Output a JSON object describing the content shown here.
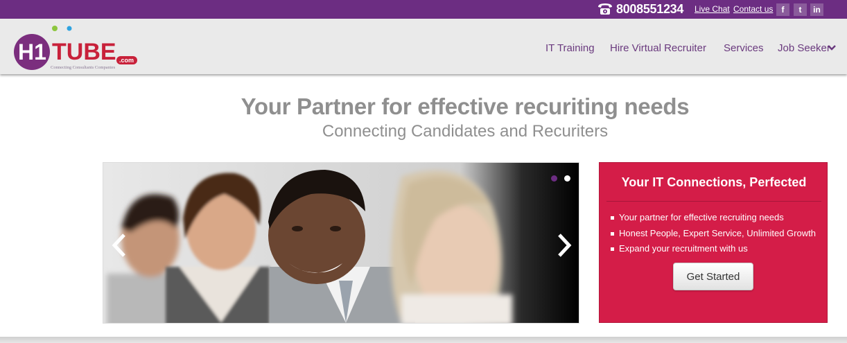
{
  "topbar": {
    "phone": "8008551234",
    "phone_icon": "telephone-icon",
    "live_chat": "Live Chat",
    "contact_us": "Contact us",
    "social": [
      {
        "icon": "facebook-icon",
        "glyph": "f"
      },
      {
        "icon": "twitter-icon",
        "glyph": "t"
      },
      {
        "icon": "linkedin-icon",
        "glyph": "in"
      }
    ],
    "bg_color": "#6c2d82"
  },
  "logo": {
    "main": "H1TUBE",
    "domain": ".com",
    "tagline": "Connecting Consultants Companies"
  },
  "nav": {
    "items": [
      "IT Training",
      "Hire Virtual Recruiter",
      "Services",
      "Job Seeker"
    ],
    "color": "#6a3a7e"
  },
  "hero": {
    "title": "Your Partner for effective recuriting needs",
    "subtitle": "Connecting Candidates and Recuriters"
  },
  "slider": {
    "slide_count": 2,
    "active_index": 0,
    "image": "smiling-professionals-team-photo"
  },
  "promo": {
    "title": "Your IT Connections, Perfected",
    "bullets": [
      "Your partner for effective recruiting needs",
      "Honest People, Expert Service, Unlimited Growth",
      "Expand your recruitment with us"
    ],
    "cta": "Get Started",
    "bg_color": "#d41d48"
  }
}
